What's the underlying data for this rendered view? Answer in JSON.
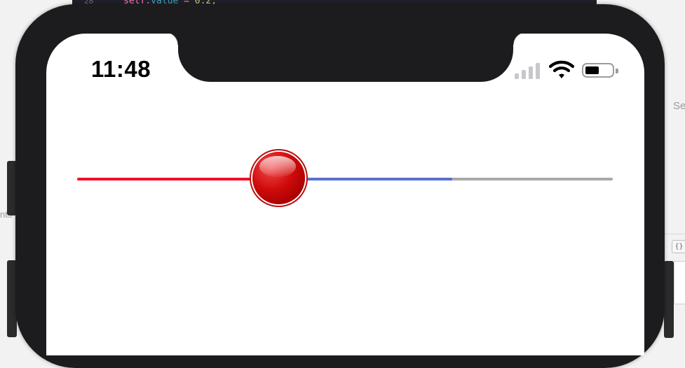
{
  "background": {
    "code_line_number": "28",
    "code_line": {
      "receiver": "self",
      "property": "value",
      "operator": " = ",
      "number": "0.2;"
    },
    "left_panel_text": "nts",
    "right_panel_text": "Se",
    "braces_button": "{}"
  },
  "status_bar": {
    "time": "11:48",
    "signal_bars_active": 0,
    "battery_level": 0.5
  },
  "slider": {
    "value": 0.375,
    "buffered": 0.7,
    "colors": {
      "minimum_track": "#f0102a",
      "buffer_track": "#5a6fd0",
      "maximum_track": "#a9a9ab",
      "thumb": "#cf0a0a"
    }
  },
  "colors": {
    "device_frame": "#1c1c1e",
    "screen": "#ffffff"
  },
  "icons": {
    "signal": "cellular-signal-icon",
    "wifi": "wifi-icon",
    "battery": "battery-icon"
  }
}
